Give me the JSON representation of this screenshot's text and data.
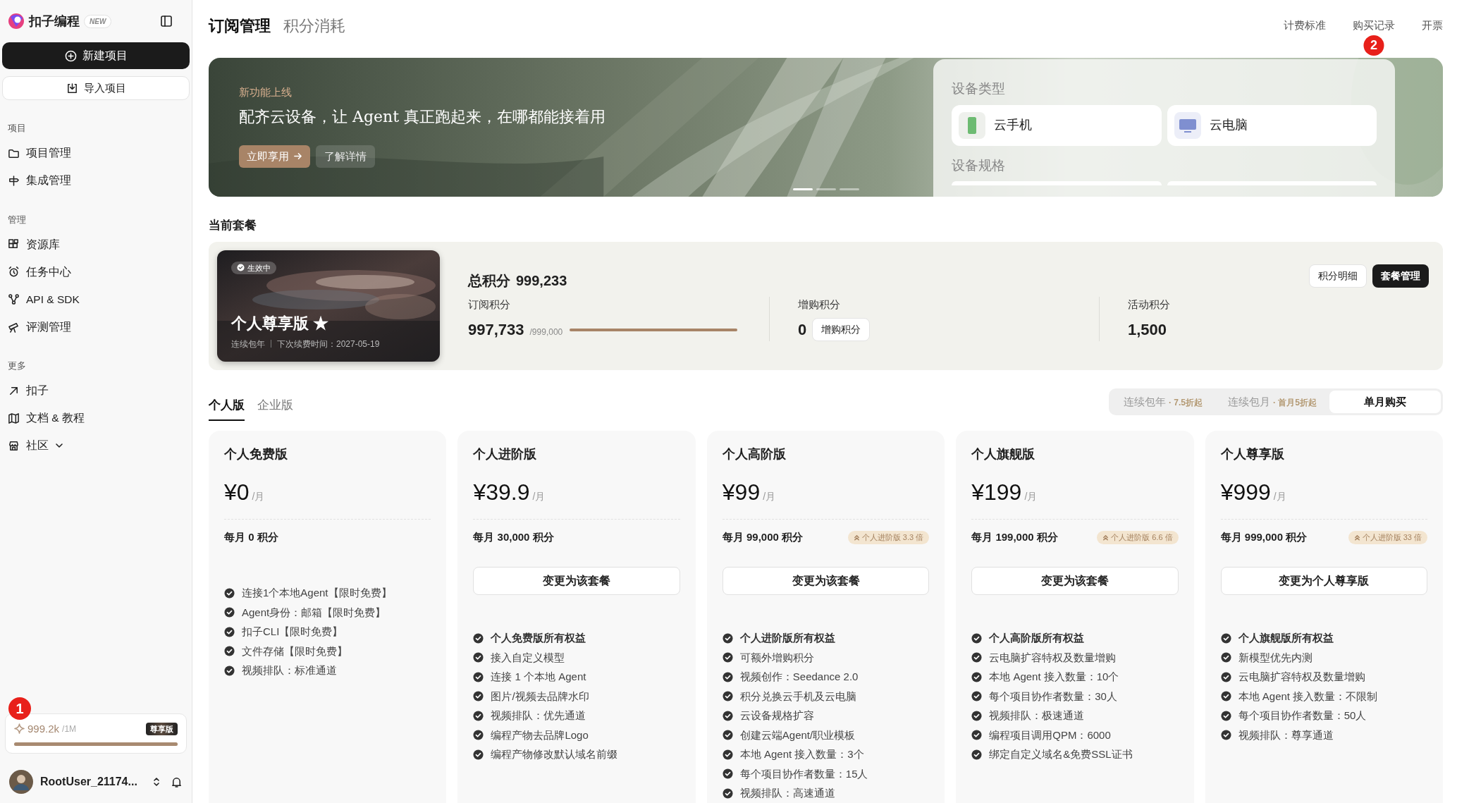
{
  "sidebar": {
    "logo": "扣子编程",
    "logo_badge": "NEW",
    "new_button": "新建项目",
    "import_button": "导入项目",
    "sections": [
      {
        "title": "项目",
        "items": [
          {
            "label": "项目管理"
          },
          {
            "label": "集成管理"
          }
        ]
      },
      {
        "title": "管理",
        "items": [
          {
            "label": "资源库"
          },
          {
            "label": "任务中心"
          },
          {
            "label": "API & SDK"
          },
          {
            "label": "评测管理"
          }
        ]
      },
      {
        "title": "更多",
        "items": [
          {
            "label": "扣子"
          },
          {
            "label": "文档 & 教程"
          },
          {
            "label": "社区"
          }
        ]
      }
    ],
    "credits": {
      "marker": "1",
      "value": "999.2k",
      "total": "/1M",
      "badge": "尊享版",
      "level": 0.999
    },
    "user": {
      "name": "RootUser_21174..."
    }
  },
  "header": {
    "tabs": [
      {
        "label": "订阅管理",
        "selected": true
      },
      {
        "label": "积分消耗",
        "selected": false
      }
    ],
    "links": [
      {
        "label": "计费标准"
      },
      {
        "label": "购买记录",
        "marker": "2"
      },
      {
        "label": "开票"
      }
    ]
  },
  "banner": {
    "eyebrow": "新功能上线",
    "headline": "配齐云设备，让 Agent 真正跑起来，在哪都能接着用",
    "primary_button": "立即享用",
    "secondary_button": "了解详情",
    "dots": [
      {
        "selected": true
      },
      {
        "selected": false
      },
      {
        "selected": false
      }
    ],
    "device_type_label": "设备类型",
    "devices": [
      {
        "label": "云手机"
      },
      {
        "label": "云电脑"
      }
    ],
    "device_spec_label": "设备规格"
  },
  "current_plan": {
    "title": "当前套餐",
    "status": "生效中",
    "name": "个人尊享版 ★",
    "billing": "连续包年",
    "renewal": "下次续费时间：2027-05-19",
    "total_label": "总积分",
    "total_value": "999,233",
    "buttons": [
      "积分明细",
      "套餐管理"
    ],
    "subscription": {
      "label": "订阅积分",
      "value": "997,733",
      "cap": "/999,000",
      "level": 0.999
    },
    "purchased": {
      "label": "增购积分",
      "value": "0",
      "button": "增购积分"
    },
    "activity": {
      "label": "活动积分",
      "value": "1,500"
    }
  },
  "plan_tabs": [
    {
      "label": "个人版",
      "selected": true
    },
    {
      "label": "企业版",
      "selected": false
    }
  ],
  "billing_options": [
    {
      "label": "连续包年",
      "note": "· 7.5折起",
      "selected": false
    },
    {
      "label": "连续包月",
      "note": "· 首月5折起",
      "selected": false
    },
    {
      "label": "单月购买",
      "selected": true
    }
  ],
  "plans": [
    {
      "name": "个人免费版",
      "price": "¥0",
      "unit": "/月",
      "credits": "每月 0 积分",
      "features": [
        {
          "text": "连接1个本地Agent【限时免费】",
          "bold": false
        },
        {
          "text": "Agent身份：邮箱【限时免费】",
          "bold": false
        },
        {
          "text": "扣子CLI【限时免费】",
          "bold": false
        },
        {
          "text": "文件存储【限时免费】",
          "bold": false
        },
        {
          "text": "视频排队：标准通道",
          "bold": false
        }
      ]
    },
    {
      "name": "个人进阶版",
      "price": "¥39.9",
      "unit": "/月",
      "credits": "每月 30,000 积分",
      "button": "变更为该套餐",
      "features": [
        {
          "text": "个人免费版所有权益",
          "bold": true
        },
        {
          "text": "接入自定义模型",
          "bold": false
        },
        {
          "text": "连接 1 个本地 Agent",
          "bold": false
        },
        {
          "text": "图片/视频去品牌水印",
          "bold": false
        },
        {
          "text": "视频排队：优先通道",
          "bold": false
        },
        {
          "text": "编程产物去品牌Logo",
          "bold": false
        },
        {
          "text": "编程产物修改默认域名前缀",
          "bold": false
        }
      ]
    },
    {
      "name": "个人高阶版",
      "price": "¥99",
      "unit": "/月",
      "credits": "每月 99,000 积分",
      "badge": "个人进阶版 3.3 倍",
      "button": "变更为该套餐",
      "features": [
        {
          "text": "个人进阶版所有权益",
          "bold": true
        },
        {
          "text": "可额外增购积分",
          "bold": false
        },
        {
          "text": "视频创作：Seedance 2.0",
          "bold": false
        },
        {
          "text": "积分兑换云手机及云电脑",
          "bold": false
        },
        {
          "text": "云设备规格扩容",
          "bold": false
        },
        {
          "text": "创建云端Agent/职业模板",
          "bold": false
        },
        {
          "text": "本地 Agent 接入数量：3个",
          "bold": false
        },
        {
          "text": "每个项目协作者数量：15人",
          "bold": false
        },
        {
          "text": "视频排队：高速通道",
          "bold": false
        }
      ]
    },
    {
      "name": "个人旗舰版",
      "price": "¥199",
      "unit": "/月",
      "credits": "每月 199,000 积分",
      "badge": "个人进阶版 6.6 倍",
      "button": "变更为该套餐",
      "features": [
        {
          "text": "个人高阶版所有权益",
          "bold": true
        },
        {
          "text": "云电脑扩容特权及数量增购",
          "bold": false
        },
        {
          "text": "本地 Agent 接入数量：10个",
          "bold": false
        },
        {
          "text": "每个项目协作者数量：30人",
          "bold": false
        },
        {
          "text": "视频排队：极速通道",
          "bold": false
        },
        {
          "text": "编程项目调用QPM：6000",
          "bold": false
        },
        {
          "text": "绑定自定义域名&免费SSL证书",
          "bold": false
        }
      ]
    },
    {
      "name": "个人尊享版",
      "price": "¥999",
      "unit": "/月",
      "credits": "每月 999,000 积分",
      "badge": "个人进阶版 33 倍",
      "button": "变更为个人尊享版",
      "features": [
        {
          "text": "个人旗舰版所有权益",
          "bold": true
        },
        {
          "text": "新模型优先内测",
          "bold": false
        },
        {
          "text": "云电脑扩容特权及数量增购",
          "bold": false
        },
        {
          "text": "本地 Agent 接入数量：不限制",
          "bold": false
        },
        {
          "text": "每个项目协作者数量：50人",
          "bold": false
        },
        {
          "text": "视频排队：尊享通道",
          "bold": false
        }
      ]
    }
  ]
}
